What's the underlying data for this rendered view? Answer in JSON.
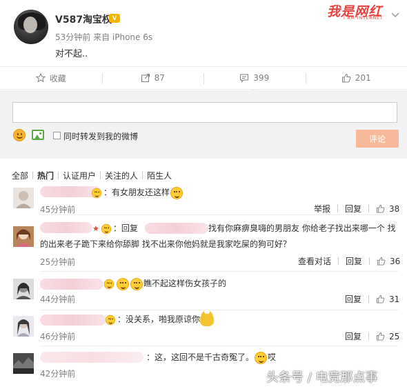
{
  "post": {
    "username": "V587淘宝权",
    "vip_badge": "V",
    "meta": "53分钟前 来自 iPhone 6s",
    "text": "对不起..",
    "watermark_logo": "我是网红",
    "watermark_sub": "I AM INTERNET"
  },
  "actions": {
    "favorite": "收藏",
    "forward": "87",
    "comment": "399",
    "like": "201"
  },
  "composer": {
    "input_value": "",
    "repost_label": "同时转发到我的微博",
    "submit_label": "评论",
    "submit_color": "#f6b99a"
  },
  "tabs": [
    "全部",
    "热门",
    "认证用户",
    "关注的人",
    "陌生人"
  ],
  "comments": [
    {
      "text": "：有女朋友还这样",
      "time": "45分钟前",
      "report": "举报",
      "reply": "回复",
      "likes": "38"
    },
    {
      "text_line1": "：回复",
      "text_mid": "找有你麻痹臭嗨的男朋友 你给老子找出来哪一个 找",
      "text_line2": "的出来老子跪下来给你舔脚 找不出来你他妈就是我家吃屎的狗可好？",
      "time": "25分钟前",
      "conversation": "查看对话",
      "reply": "回复",
      "likes": "36"
    },
    {
      "text": "瞧不起这样伤女孩子的",
      "time": "44分钟前",
      "reply": "回复",
      "likes": "31"
    },
    {
      "text": "：没关系，啪我原谅你",
      "time": "46分钟前",
      "reply": "回复",
      "likes": "25"
    },
    {
      "text_a": "：这，这回不是千古奇冤了。",
      "text_b": "哎",
      "time": "42分钟前"
    }
  ],
  "footer_watermark": "头条号 / 电竞那点事",
  "colors": {
    "accent": "#f6b99a",
    "brand_red": "#e8423d",
    "muted": "#808080"
  }
}
